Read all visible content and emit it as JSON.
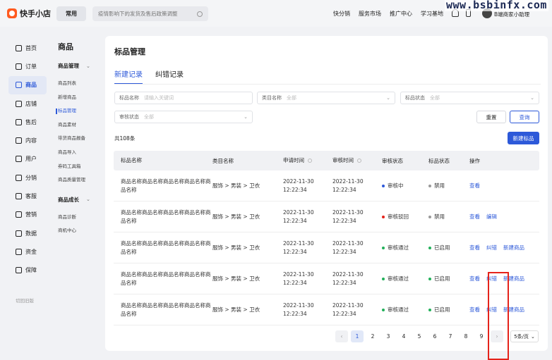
{
  "topbar": {
    "brand": "快手小店",
    "common_label": "常用",
    "search_placeholder": "疫情影响下的发货及售后政策调整",
    "nav": [
      "快分销",
      "服务市场",
      "推广中心",
      "学习基地"
    ],
    "user_name": "B端商家小助理"
  },
  "watermark": "www.bsbinfx.com",
  "sidebar": {
    "items": [
      {
        "label": "首页",
        "icon": "home-icon"
      },
      {
        "label": "订单",
        "icon": "order-icon"
      },
      {
        "label": "商品",
        "icon": "goods-icon",
        "active": true
      },
      {
        "label": "店铺",
        "icon": "store-icon"
      },
      {
        "label": "售后",
        "icon": "aftersale-icon"
      },
      {
        "label": "内容",
        "icon": "content-icon"
      },
      {
        "label": "用户",
        "icon": "user-icon"
      },
      {
        "label": "分销",
        "icon": "distribution-icon"
      },
      {
        "label": "客服",
        "icon": "service-icon"
      },
      {
        "label": "营销",
        "icon": "marketing-icon"
      },
      {
        "label": "数据",
        "icon": "data-icon"
      },
      {
        "label": "资金",
        "icon": "funds-icon"
      },
      {
        "label": "保障",
        "icon": "shield-icon"
      }
    ],
    "switch_old": "切回旧版"
  },
  "subnav": {
    "title": "商品",
    "group1": "商品管理",
    "group1_items": [
      "商品列表",
      "新增商品",
      "标品管理",
      "商品素材",
      "带货商品报备",
      "商品导入",
      "券码工具箱",
      "商品质量管理"
    ],
    "group2": "商品成长",
    "group2_items": [
      "商品诊断",
      "商机中心"
    ]
  },
  "page": {
    "title": "标品管理",
    "tabs": [
      "新建记录",
      "纠错记录"
    ],
    "filters": [
      {
        "label": "标品名称",
        "placeholder": "请输入关键词"
      },
      {
        "label": "类目名称",
        "placeholder": "全部"
      },
      {
        "label": "标品状态",
        "placeholder": "全部"
      },
      {
        "label": "审核状态",
        "placeholder": "全部"
      }
    ],
    "reset_label": "重置",
    "query_label": "查询",
    "total": "共108条",
    "new_button": "新建标品"
  },
  "table": {
    "headers": [
      "标品名称",
      "类目名称",
      "申请时间",
      "审核时间",
      "审核状态",
      "标品状态",
      "操作"
    ],
    "rows": [
      {
        "name": "商品名称商品名称商品名称商品名称商品名称",
        "category": "服饰 > 男装 > 卫衣",
        "apply_date": "2022-11-30",
        "apply_time": "12:22:34",
        "audit_date": "2022-11-30",
        "audit_time": "12:22:34",
        "audit_status": "审核中",
        "audit_color": "#2d59d9",
        "item_status": "禁用",
        "item_color": "#999999",
        "actions": [
          "查看"
        ]
      },
      {
        "name": "商品名称商品名称商品名称商品名称商品名称",
        "category": "服饰 > 男装 > 卫衣",
        "apply_date": "2022-11-30",
        "apply_time": "12:22:34",
        "audit_date": "2022-11-30",
        "audit_time": "12:22:34",
        "audit_status": "审核驳回",
        "audit_color": "#e5231b",
        "item_status": "禁用",
        "item_color": "#999999",
        "actions": [
          "查看",
          "编辑"
        ]
      },
      {
        "name": "商品名称商品名称商品名称商品名称商品名称",
        "category": "服饰 > 男装 > 卫衣",
        "apply_date": "2022-11-30",
        "apply_time": "12:22:34",
        "audit_date": "2022-11-30",
        "audit_time": "12:22:34",
        "audit_status": "审核通过",
        "audit_color": "#22b15a",
        "item_status": "已启用",
        "item_color": "#22b15a",
        "actions": [
          "查看",
          "纠错",
          "新建商品"
        ]
      },
      {
        "name": "商品名称商品名称商品名称商品名称商品名称",
        "category": "服饰 > 男装 > 卫衣",
        "apply_date": "2022-11-30",
        "apply_time": "12:22:34",
        "audit_date": "2022-11-30",
        "audit_time": "12:22:34",
        "audit_status": "审核通过",
        "audit_color": "#22b15a",
        "item_status": "已启用",
        "item_color": "#22b15a",
        "actions": [
          "查看",
          "纠错",
          "新建商品"
        ]
      },
      {
        "name": "商品名称商品名称商品名称商品名称商品名称",
        "category": "服饰 > 男装 > 卫衣",
        "apply_date": "2022-11-30",
        "apply_time": "12:22:34",
        "audit_date": "2022-11-30",
        "audit_time": "12:22:34",
        "audit_status": "审核通过",
        "audit_color": "#22b15a",
        "item_status": "已启用",
        "item_color": "#22b15a",
        "actions": [
          "查看",
          "纠错",
          "新建商品"
        ]
      }
    ]
  },
  "pagination": {
    "prev": "‹",
    "next": "›",
    "pages": [
      "1",
      "2",
      "3",
      "4",
      "5",
      "6",
      "7",
      "8",
      "9"
    ],
    "current": "1",
    "page_size": "5条/页"
  },
  "colors": {
    "accent": "#2d59d9",
    "brand": "#ff5a1f",
    "highlight_box": "#e5231b"
  }
}
